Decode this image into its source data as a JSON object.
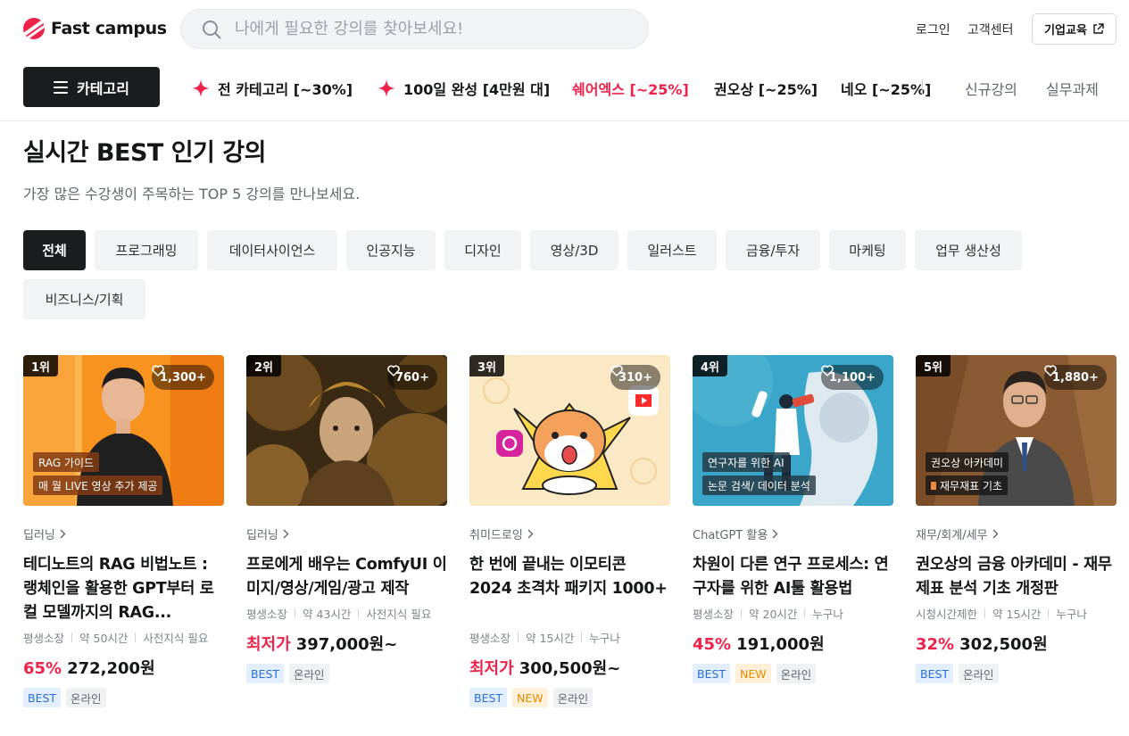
{
  "header": {
    "logo_text": "Fast campus",
    "search_placeholder": "나에게 필요한 강의를 찾아보세요!",
    "login": "로그인",
    "support": "고객센터",
    "business": "기업교육"
  },
  "nav": {
    "category_button": "카테고리",
    "items": [
      {
        "label": "전 카테고리 [~30%]",
        "icon": "sparkle-icon"
      },
      {
        "label": "100일 완성 [4만원 대]",
        "icon": "sparkle-icon"
      },
      {
        "label": "쉐어엑스 [~25%]"
      },
      {
        "label": "권오상 [~25%]"
      },
      {
        "label": "네오 [~25%]"
      },
      {
        "label": "신규강의"
      },
      {
        "label": "실무과제"
      }
    ]
  },
  "section": {
    "title": "실시간 BEST 인기 강의",
    "subtitle": "가장 많은 수강생이 주목하는 TOP 5 강의를 만나보세요."
  },
  "filters": [
    "전체",
    "프로그래밍",
    "데이터사이언스",
    "인공지능",
    "디자인",
    "영상/3D",
    "일러스트",
    "금융/투자",
    "마케팅",
    "업무 생산성",
    "비즈니스/기획"
  ],
  "courses": [
    {
      "rank": "1위",
      "likes": "1,300+",
      "tags": [
        "RAG 가이드",
        "매 월 LIVE 영상 추가 제공"
      ],
      "category": "딥러닝",
      "title": "테디노트의 RAG 비법노트 : 랭체인을 활용한 GPT부터 로컬 모델까지의 RAG...",
      "meta": [
        "평생소장",
        "약 50시간",
        "사전지식 필요"
      ],
      "discount": "65%",
      "price": "272,200원",
      "badges": [
        "BEST",
        "온라인"
      ]
    },
    {
      "rank": "2위",
      "likes": "760+",
      "tags": [],
      "category": "딥러닝",
      "title": "프로에게 배우는 ComfyUI 이미지/영상/게임/광고 제작",
      "meta": [
        "평생소장",
        "약 43시간",
        "사전지식 필요"
      ],
      "discount": "최저가",
      "price": "397,000원~",
      "badges": [
        "BEST",
        "온라인"
      ]
    },
    {
      "rank": "3위",
      "likes": "310+",
      "tags": [],
      "category": "취미드로잉",
      "title": "한 번에 끝내는 이모티콘 2024 초격차 패키지 1000+",
      "meta": [
        "평생소장",
        "약 15시간",
        "누구나"
      ],
      "discount": "최저가",
      "price": "300,500원~",
      "badges": [
        "BEST",
        "NEW",
        "온라인"
      ]
    },
    {
      "rank": "4위",
      "likes": "1,100+",
      "tags": [
        "연구자를 위한 AI",
        "논문 검색/ 데이터 분석"
      ],
      "category": "ChatGPT 활용",
      "title": "차원이 다른 연구 프로세스: 연구자를 위한 AI툴 활용법",
      "meta": [
        "평생소장",
        "약 20시간",
        "누구나"
      ],
      "discount": "45%",
      "price": "191,000원",
      "badges": [
        "BEST",
        "NEW",
        "온라인"
      ]
    },
    {
      "rank": "5위",
      "likes": "1,880+",
      "tags": [
        "권오상 아카데미",
        "재무재표 기초"
      ],
      "category": "재무/회계/세무",
      "title": "권오상의 금융 아카데미 - 재무제표 분석 기초 개정판",
      "meta": [
        "시청시간제한",
        "약 15시간",
        "누구나"
      ],
      "discount": "32%",
      "price": "302,500원",
      "badges": [
        "BEST",
        "온라인"
      ]
    }
  ],
  "colors": {
    "accent": "#ed234b",
    "dark": "#1b1c1e",
    "best": "#2a6fd6",
    "new": "#e68a00"
  }
}
